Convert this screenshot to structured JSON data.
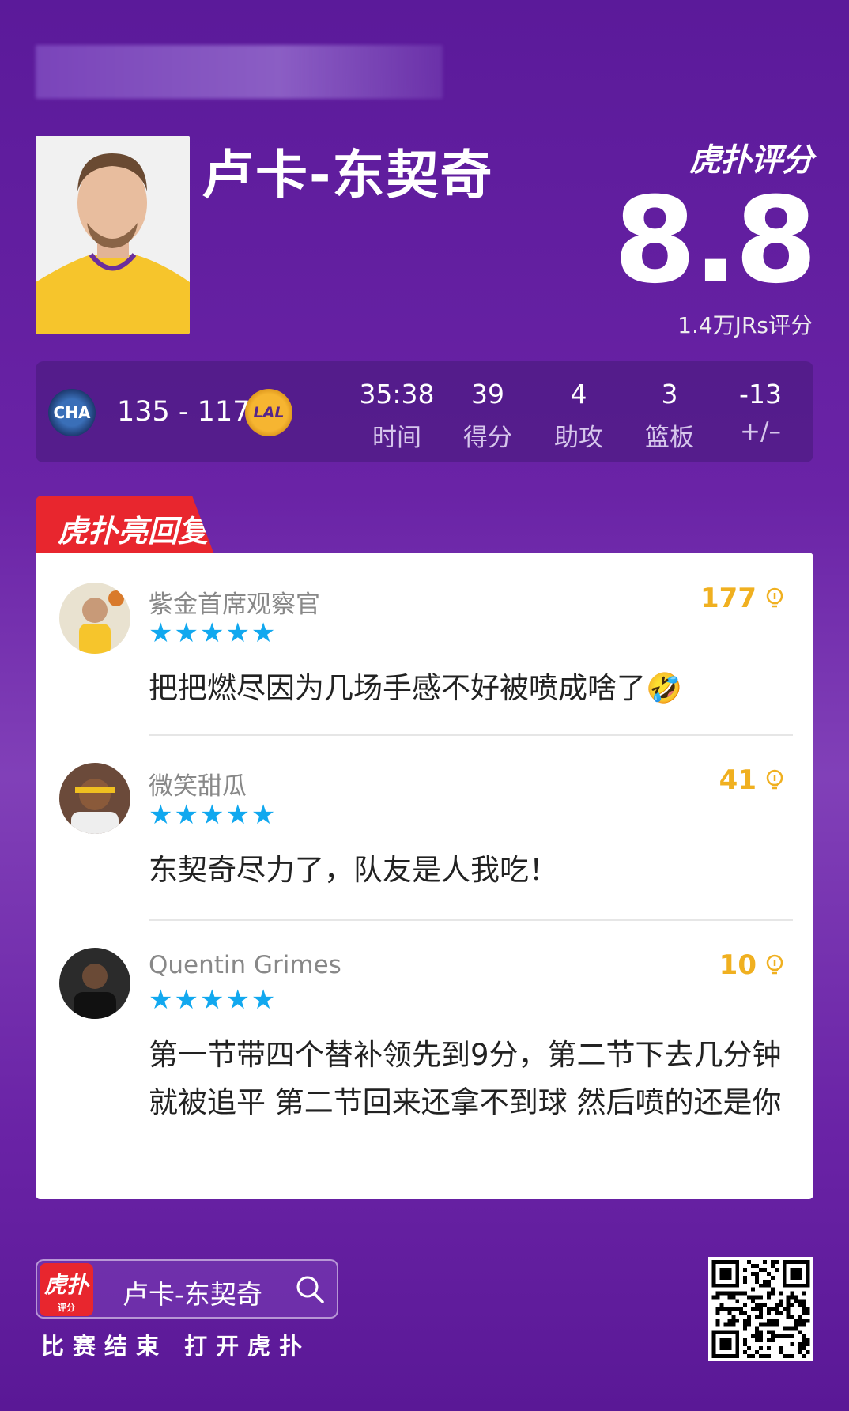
{
  "player": {
    "name": "卢卡-东契奇"
  },
  "rating": {
    "brand": "虎扑评分",
    "score": "8.8",
    "count": "1.4万JRs评分"
  },
  "game": {
    "home_team": "CHA",
    "away_team": "LAL",
    "score": "135 - 117"
  },
  "stats": [
    {
      "value": "35:38",
      "label": "时间"
    },
    {
      "value": "39",
      "label": "得分"
    },
    {
      "value": "4",
      "label": "助攻"
    },
    {
      "value": "3",
      "label": "篮板"
    },
    {
      "value": "-13",
      "label": "+/–"
    }
  ],
  "section_tag": "虎扑亮回复",
  "replies": [
    {
      "user": "紫金首席观察官",
      "likes": "177",
      "stars": 5,
      "text": "把把燃尽因为几场手感不好被喷成啥了🤣",
      "avatar_color": "#e9e2d0"
    },
    {
      "user": "微笑甜瓜",
      "likes": "41",
      "stars": 5,
      "text": "东契奇尽力了，队友是人我吃！",
      "avatar_color": "#6b4a3a"
    },
    {
      "user": "Quentin Grimes",
      "likes": "10",
      "stars": 5,
      "text": "第一节带四个替补领先到9分，第二节下去几分钟就被追平 第二节回来还拿不到球 然后喷的还是你",
      "avatar_color": "#2b2b2b"
    }
  ],
  "footer": {
    "app_icon_text": "虎扑",
    "app_icon_sub": "评分",
    "search_text": "卢卡-东契奇",
    "caption": "比赛结束 打开虎扑"
  },
  "colors": {
    "accent_red": "#e8262e",
    "star_blue": "#11a8ef",
    "likes_gold": "#f0b020"
  }
}
